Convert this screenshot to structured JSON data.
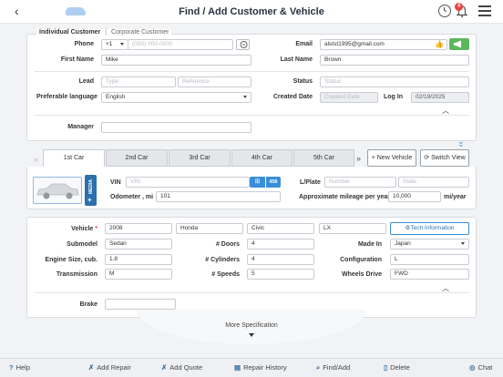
{
  "header": {
    "title": "Find / Add Customer & Vehicle",
    "back_glyph": "‹",
    "notification_count": "4"
  },
  "customer_type": {
    "individual": "Individual Customer",
    "divider": "|",
    "corporate": "Corporate Customer"
  },
  "customer": {
    "phone_label": "Phone",
    "phone_code": "+1",
    "phone_placeholder": "(000) 000-0000",
    "email_label": "Email",
    "email_value": "alstst1995@gmail.com",
    "first_name_label": "First Name",
    "first_name_value": "Mike",
    "last_name_label": "Last Name",
    "last_name_value": "Brown",
    "lead_label": "Lead",
    "lead_type_placeholder": "Type",
    "lead_reference_placeholder": "Reference",
    "status_label": "Status",
    "status_placeholder": "Status",
    "pref_lang_label": "Preferable language",
    "pref_lang_value": "English",
    "created_date_label": "Created Date",
    "created_date_placeholder": "Created Date",
    "login_label": "Log In",
    "login_value": "02/19/2025",
    "manager_label": "Manager",
    "manager_value": ""
  },
  "car_tabs": {
    "prev_glyph": "«",
    "next_glyph": "»",
    "tabs": [
      "1st Car",
      "2nd Car",
      "3rd Car",
      "4th Car",
      "5th Car"
    ],
    "new_vehicle": "+ New Vehicle",
    "switch_view": "Switch View",
    "media_label": "MEDIA",
    "media_plus": "+"
  },
  "vehicle_id": {
    "vin_label": "VIN",
    "vin_placeholder": "VIN",
    "vin_btn_1": "⊞",
    "vin_btn_2": "456",
    "odometer_label": "Odometer , mi",
    "odometer_value": "101",
    "plate_label": "L/Plate",
    "plate_placeholder": "Number",
    "state_placeholder": "State",
    "mileage_label": "Approximate mileage per year",
    "mileage_value": "10,000",
    "mileage_unit": "mi/year"
  },
  "vehicle": {
    "vehicle_label": "Vehicle",
    "required_mark": "*",
    "year": "2008",
    "make": "Honda",
    "model": "Civic",
    "trim": "LX",
    "tech_info": "Tech Information",
    "submodel_label": "Submodel",
    "submodel_value": "Sedan",
    "doors_label": "# Doors",
    "doors_value": "4",
    "made_in_label": "Made In",
    "made_in_value": "Japan",
    "engine_label": "Engine Size, cub.",
    "engine_value": "1.8",
    "cylinders_label": "# Cylinders",
    "cylinders_value": "4",
    "config_label": "Configuration",
    "config_value": "L",
    "transmission_label": "Transmission",
    "transmission_value": "M",
    "speeds_label": "# Speeds",
    "speeds_value": "5",
    "wheels_label": "Wheels Drive",
    "wheels_value": "FWD",
    "brake_label": "Brake",
    "brake_value": "",
    "more_spec": "More Specification"
  },
  "bottom_bar": {
    "help": "Help",
    "add_repair": "Add Repair",
    "add_quote": "Add Quote",
    "repair_history": "Repair History",
    "find_add": "Find/Add",
    "delete": "Delete",
    "chat": "Chat"
  },
  "colors": {
    "accent_blue": "#3a8ed8",
    "green": "#5cb85c",
    "badge_red": "#e8423f",
    "media_blue": "#2c6fae"
  }
}
